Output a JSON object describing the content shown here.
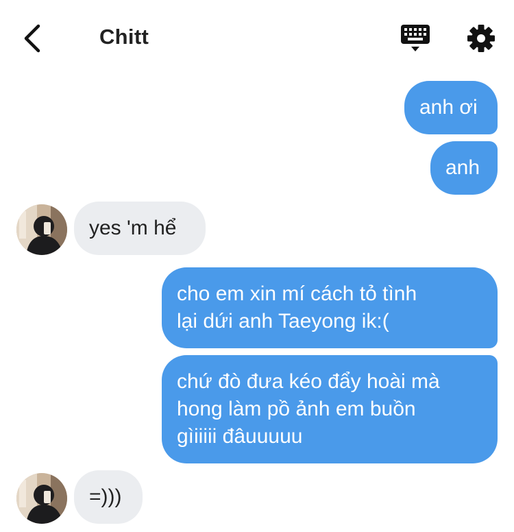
{
  "header": {
    "title": "Chitt",
    "back_icon": "chevron-left-icon",
    "keyboard_icon": "keyboard-icon",
    "settings_icon": "gear-icon"
  },
  "colors": {
    "outgoing_bubble": "#4a9aea",
    "incoming_bubble": "#ebedf0",
    "outgoing_text": "#ffffff",
    "incoming_text": "#222222"
  },
  "messages": [
    {
      "from": "me",
      "lines": [
        "anh ơi"
      ]
    },
    {
      "from": "me",
      "lines": [
        "anh"
      ]
    },
    {
      "from": "them",
      "lines": [
        "yes 'm hể"
      ]
    },
    {
      "from": "me",
      "lines": [
        "cho em xin mí cách tỏ tình",
        "lại dứi anh Taeyong ik:("
      ]
    },
    {
      "from": "me",
      "lines": [
        "chứ đò đưa kéo đẩy hoài mà",
        "hong làm pồ ảnh em buồn",
        "gìiiiii đâuuuuu"
      ]
    },
    {
      "from": "them",
      "lines": [
        "=)))"
      ]
    }
  ]
}
